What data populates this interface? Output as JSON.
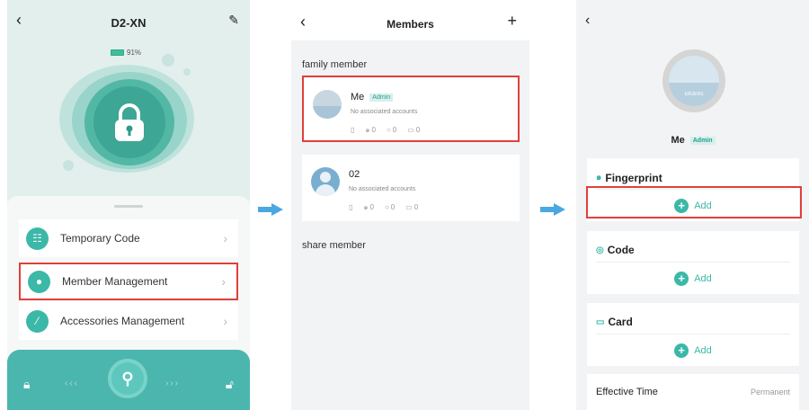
{
  "screen1": {
    "title": "D2-XN",
    "battery_label": "91%",
    "menu": [
      {
        "label": "Temporary Code"
      },
      {
        "label": "Member Management"
      },
      {
        "label": "Accessories Management"
      }
    ]
  },
  "screen2": {
    "title": "Members",
    "family_section": "family member",
    "share_section": "share member",
    "members": [
      {
        "name": "Me",
        "badge": "Admin",
        "sub": "No associated accounts",
        "fp": "0",
        "code": "0",
        "card": "0"
      },
      {
        "name": "02",
        "badge": "",
        "sub": "No associated accounts",
        "fp": "0",
        "code": "0",
        "card": "0"
      }
    ]
  },
  "screen3": {
    "avatar_text": "ERUERS",
    "name": "Me",
    "badge": "Admin",
    "sections": [
      {
        "title": "Fingerprint",
        "add": "Add"
      },
      {
        "title": "Code",
        "add": "Add"
      },
      {
        "title": "Card",
        "add": "Add"
      }
    ],
    "effective_label": "Effective Time",
    "effective_value": "Permanent"
  },
  "colors": {
    "accent": "#3bb8a7",
    "highlight": "#e0403a",
    "arrow": "#4aa8e0"
  }
}
